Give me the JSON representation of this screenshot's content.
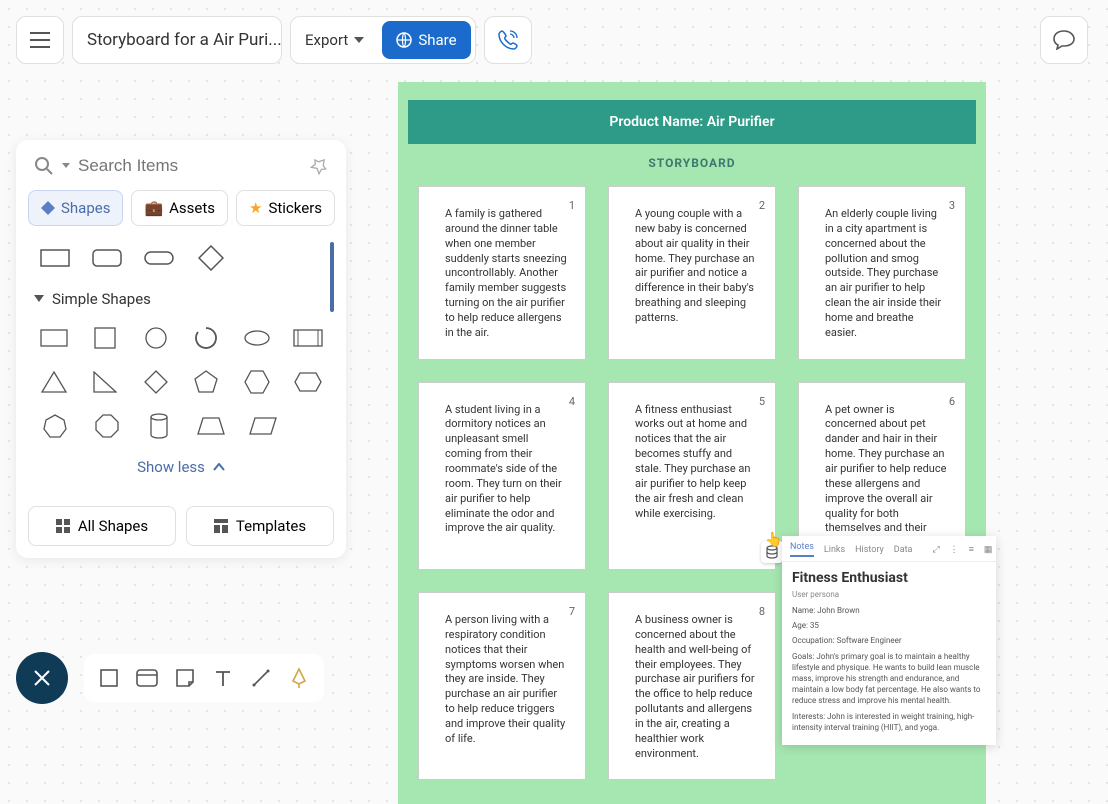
{
  "header": {
    "title": "Storyboard for a Air Puri...",
    "export_label": "Export",
    "share_label": "Share"
  },
  "left_panel": {
    "search_placeholder": "Search Items",
    "tabs": {
      "shapes": "Shapes",
      "assets": "Assets",
      "stickers": "Stickers"
    },
    "section_title": "Simple Shapes",
    "show_less": "Show less",
    "all_shapes": "All Shapes",
    "templates": "Templates"
  },
  "storyboard": {
    "product_line": "Product Name: Air Purifier",
    "label": "STORYBOARD",
    "cards": [
      {
        "num": "1",
        "text": "A family is gathered around the dinner table when one member suddenly starts sneezing uncontrollably. Another family member suggests turning on the air purifier to help reduce allergens in the air."
      },
      {
        "num": "2",
        "text": "A young couple with a new baby is concerned about air quality in their home. They purchase an air purifier and notice a difference in their baby's breathing and sleeping patterns."
      },
      {
        "num": "3",
        "text": "An elderly couple living in a city apartment is concerned about the pollution and smog outside. They purchase an air purifier to help clean the air inside their home and breathe easier."
      },
      {
        "num": "4",
        "text": "A student living in a dormitory notices an unpleasant smell coming from their roommate's side of the room. They turn on their air purifier to help eliminate the odor and improve the air quality."
      },
      {
        "num": "5",
        "text": "A fitness enthusiast works out at home and notices that the air becomes stuffy and stale. They purchase an air purifier to help keep the air fresh and clean while exercising."
      },
      {
        "num": "6",
        "text": "A pet owner is concerned about pet dander and hair in their home. They purchase an air purifier to help reduce these allergens and improve the overall air quality for both themselves and their pets."
      },
      {
        "num": "7",
        "text": "A person living with a respiratory condition notices that their symptoms worsen when they are inside. They purchase an air purifier to help reduce triggers and improve their quality of life."
      },
      {
        "num": "8",
        "text": "A business owner is concerned about the health and well-being of their employees. They purchase air purifiers for the office to help reduce pollutants and allergens in the air, creating a healthier work environment."
      }
    ]
  },
  "notes": {
    "tabs": {
      "notes": "Notes",
      "links": "Links",
      "history": "History",
      "data": "Data"
    },
    "title": "Fitness Enthusiast",
    "subtitle": "User persona",
    "name": "Name: John Brown",
    "age": "Age: 35",
    "occupation": "Occupation: Software Engineer",
    "goals": "Goals: John's primary goal is to maintain a healthy lifestyle and physique. He wants to build lean muscle mass, improve his strength and endurance, and maintain a low body fat percentage. He also wants to reduce stress and improve his mental health.",
    "interests": "Interests: John is interested in weight training, high-intensity interval training (HIIT), and yoga."
  }
}
